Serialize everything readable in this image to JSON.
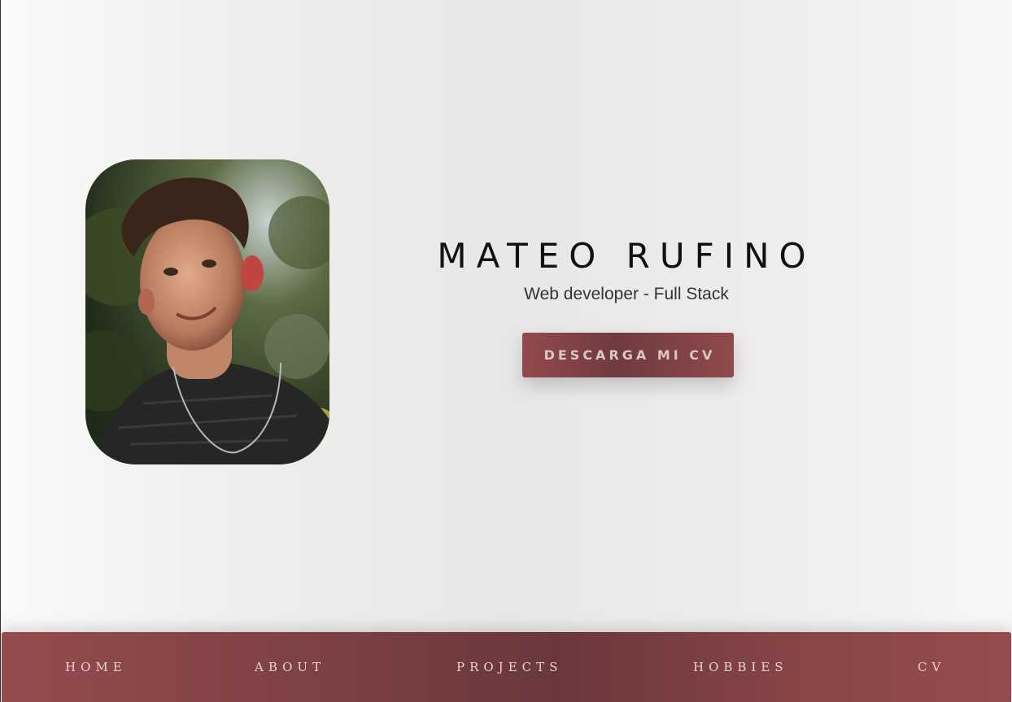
{
  "hero": {
    "name": "MATEO RUFINO",
    "role": "Web developer - Full Stack",
    "cv_button_label": "DESCARGA MI CV"
  },
  "nav": {
    "items": [
      {
        "label": "HOME"
      },
      {
        "label": "ABOUT"
      },
      {
        "label": "PROJECTS"
      },
      {
        "label": "HOBBIES"
      },
      {
        "label": "CV"
      }
    ]
  },
  "colors": {
    "accent": "#8a4447",
    "background": "#efedeb",
    "text": "#111111"
  }
}
